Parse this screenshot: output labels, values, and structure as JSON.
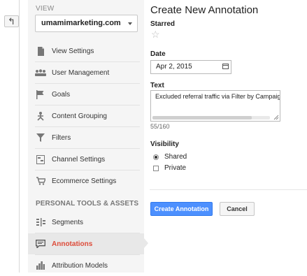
{
  "sidebar": {
    "view_label": "VIEW",
    "view_selected": "umamimarketing.com",
    "items": [
      {
        "label": "View Settings",
        "icon": "document-icon"
      },
      {
        "label": "User Management",
        "icon": "users-icon"
      },
      {
        "label": "Goals",
        "icon": "flag-icon"
      },
      {
        "label": "Content Grouping",
        "icon": "content-grouping-icon"
      },
      {
        "label": "Filters",
        "icon": "filter-icon"
      },
      {
        "label": "Channel Settings",
        "icon": "channel-settings-icon"
      },
      {
        "label": "Ecommerce Settings",
        "icon": "cart-icon"
      }
    ],
    "section_title": "PERSONAL TOOLS & ASSETS",
    "tools": [
      {
        "label": "Segments",
        "icon": "segments-icon"
      },
      {
        "label": "Annotations",
        "icon": "annotation-icon",
        "active": true
      },
      {
        "label": "Attribution Models",
        "icon": "attribution-icon"
      }
    ]
  },
  "form": {
    "title": "Create New Annotation",
    "starred_label": "Starred",
    "date_label": "Date",
    "date_value": "Apr 2, 2015",
    "text_label": "Text",
    "text_value": "Excluded referral traffic via Filter by Campaig",
    "char_count": "55/160",
    "visibility_label": "Visibility",
    "visibility_options": [
      {
        "label": "Shared",
        "checked": true
      },
      {
        "label": "Private",
        "checked": false
      }
    ],
    "create_button": "Create Annotation",
    "cancel_button": "Cancel"
  },
  "colors": {
    "accent": "#4d90fe",
    "active_text": "#dd4b39",
    "sidebar_bg": "#f5f5f5"
  }
}
